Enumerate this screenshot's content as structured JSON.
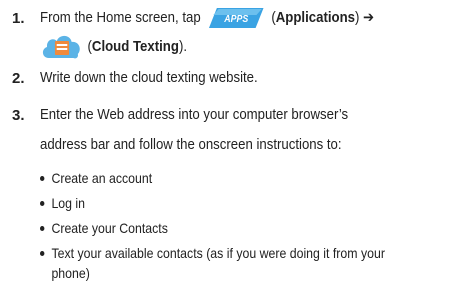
{
  "steps": [
    {
      "number": "1.",
      "pre": "From the Home screen, tap",
      "apps_badge": "APPS",
      "applications_open": "(",
      "applications_label": "Applications",
      "applications_close": ")",
      "arrow": "➔",
      "cloud_open": "(",
      "cloud_label": "Cloud Texting",
      "cloud_close": ")."
    },
    {
      "number": "2.",
      "text": "Write down the cloud texting website."
    },
    {
      "number": "3.",
      "line1": "Enter the Web address into your computer browser’s",
      "line2": "address bar and follow the onscreen instructions to:"
    }
  ],
  "bullets": [
    "Create an account",
    "Log in",
    "Create your Contacts",
    "Text your available contacts (as if you were doing it from your"
  ],
  "bullet_continuation": "phone)",
  "colors": {
    "text": "#222222",
    "apps_badge": "#3aa3e3",
    "cloud_icon": "#5bb3e6",
    "cloud_note": "#f08a3c"
  },
  "icons": {
    "apps": "apps-badge-icon",
    "cloud": "cloud-texting-icon"
  }
}
